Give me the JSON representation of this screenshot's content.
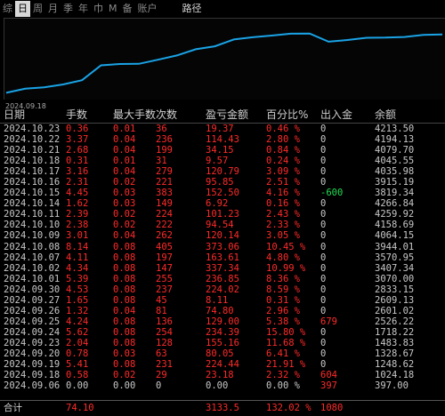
{
  "tabs": [
    "综",
    "日",
    "周",
    "月",
    "季",
    "年",
    "巾",
    "M",
    "备",
    "账户"
  ],
  "active_tab": "日",
  "path_label": "路径",
  "chart": {
    "start_date": "2024.09.18",
    "line_color": "#1aa3e6",
    "values": [
      1024.18,
      1248.62,
      1328.67,
      1483.83,
      1718.22,
      2526.22,
      2601.02,
      2609.13,
      2833.15,
      3070.0,
      3407.34,
      3570.95,
      3944.01,
      4064.15,
      4158.69,
      4259.92,
      4266.84,
      3819.34,
      3915.19,
      4035.98,
      4045.55,
      4079.7,
      4194.13,
      4213.5
    ]
  },
  "headers": [
    "日期",
    "手数",
    "最大手数",
    "次数",
    "盈亏金额",
    "百分比%",
    "出入金",
    "余额"
  ],
  "rows": [
    [
      "2024.10.23",
      "0.36",
      "0.01",
      "36",
      "19.37",
      "0.46 %",
      "0",
      "4213.50"
    ],
    [
      "2024.10.22",
      "3.37",
      "0.04",
      "236",
      "114.43",
      "2.80 %",
      "0",
      "4194.13"
    ],
    [
      "2024.10.21",
      "2.68",
      "0.04",
      "199",
      "34.15",
      "0.84 %",
      "0",
      "4079.70"
    ],
    [
      "2024.10.18",
      "0.31",
      "0.01",
      "31",
      "9.57",
      "0.24 %",
      "0",
      "4045.55"
    ],
    [
      "2024.10.17",
      "3.16",
      "0.04",
      "279",
      "120.79",
      "3.09 %",
      "0",
      "4035.98"
    ],
    [
      "2024.10.16",
      "2.31",
      "0.02",
      "221",
      "95.85",
      "2.51 %",
      "0",
      "3915.19"
    ],
    [
      "2024.10.15",
      "4.45",
      "0.03",
      "383",
      "152.50",
      "4.16 %",
      "-600",
      "3819.34"
    ],
    [
      "2024.10.14",
      "1.62",
      "0.03",
      "149",
      "6.92",
      "0.16 %",
      "0",
      "4266.84"
    ],
    [
      "2024.10.11",
      "2.39",
      "0.02",
      "224",
      "101.23",
      "2.43 %",
      "0",
      "4259.92"
    ],
    [
      "2024.10.10",
      "2.38",
      "0.02",
      "222",
      "94.54",
      "2.33 %",
      "0",
      "4158.69"
    ],
    [
      "2024.10.09",
      "3.01",
      "0.04",
      "262",
      "120.14",
      "3.05 %",
      "0",
      "4064.15"
    ],
    [
      "2024.10.08",
      "8.14",
      "0.08",
      "405",
      "373.06",
      "10.45 %",
      "0",
      "3944.01"
    ],
    [
      "2024.10.07",
      "4.11",
      "0.08",
      "197",
      "163.61",
      "4.80 %",
      "0",
      "3570.95"
    ],
    [
      "2024.10.02",
      "4.34",
      "0.08",
      "147",
      "337.34",
      "10.99 %",
      "0",
      "3407.34"
    ],
    [
      "2024.10.01",
      "5.39",
      "0.08",
      "255",
      "236.85",
      "8.36 %",
      "0",
      "3070.00"
    ],
    [
      "2024.09.30",
      "4.53",
      "0.08",
      "237",
      "224.02",
      "8.59 %",
      "0",
      "2833.15"
    ],
    [
      "2024.09.27",
      "1.65",
      "0.08",
      "45",
      "8.11",
      "0.31 %",
      "0",
      "2609.13"
    ],
    [
      "2024.09.26",
      "1.32",
      "0.04",
      "81",
      "74.80",
      "2.96 %",
      "0",
      "2601.02"
    ],
    [
      "2024.09.25",
      "4.24",
      "0.08",
      "136",
      "129.00",
      "5.38 %",
      "679",
      "2526.22"
    ],
    [
      "2024.09.24",
      "5.62",
      "0.08",
      "254",
      "234.39",
      "15.80 %",
      "0",
      "1718.22"
    ],
    [
      "2024.09.23",
      "2.04",
      "0.08",
      "128",
      "155.16",
      "11.68 %",
      "0",
      "1483.83"
    ],
    [
      "2024.09.20",
      "0.78",
      "0.03",
      "63",
      "80.05",
      "6.41 %",
      "0",
      "1328.67"
    ],
    [
      "2024.09.19",
      "5.41",
      "0.08",
      "231",
      "224.44",
      "21.91 %",
      "0",
      "1248.62"
    ],
    [
      "2024.09.18",
      "0.58",
      "0.02",
      "29",
      "23.18",
      "2.32 %",
      "604",
      "1024.18"
    ],
    [
      "2024.09.06",
      "0.00",
      "0.00",
      "0",
      "0.00",
      "0.00 %",
      "397",
      "397.00"
    ]
  ],
  "total": {
    "label": "合计",
    "lots": "74.10",
    "pnl": "3133.5",
    "pct": "132.02 %",
    "flow": "1080"
  }
}
